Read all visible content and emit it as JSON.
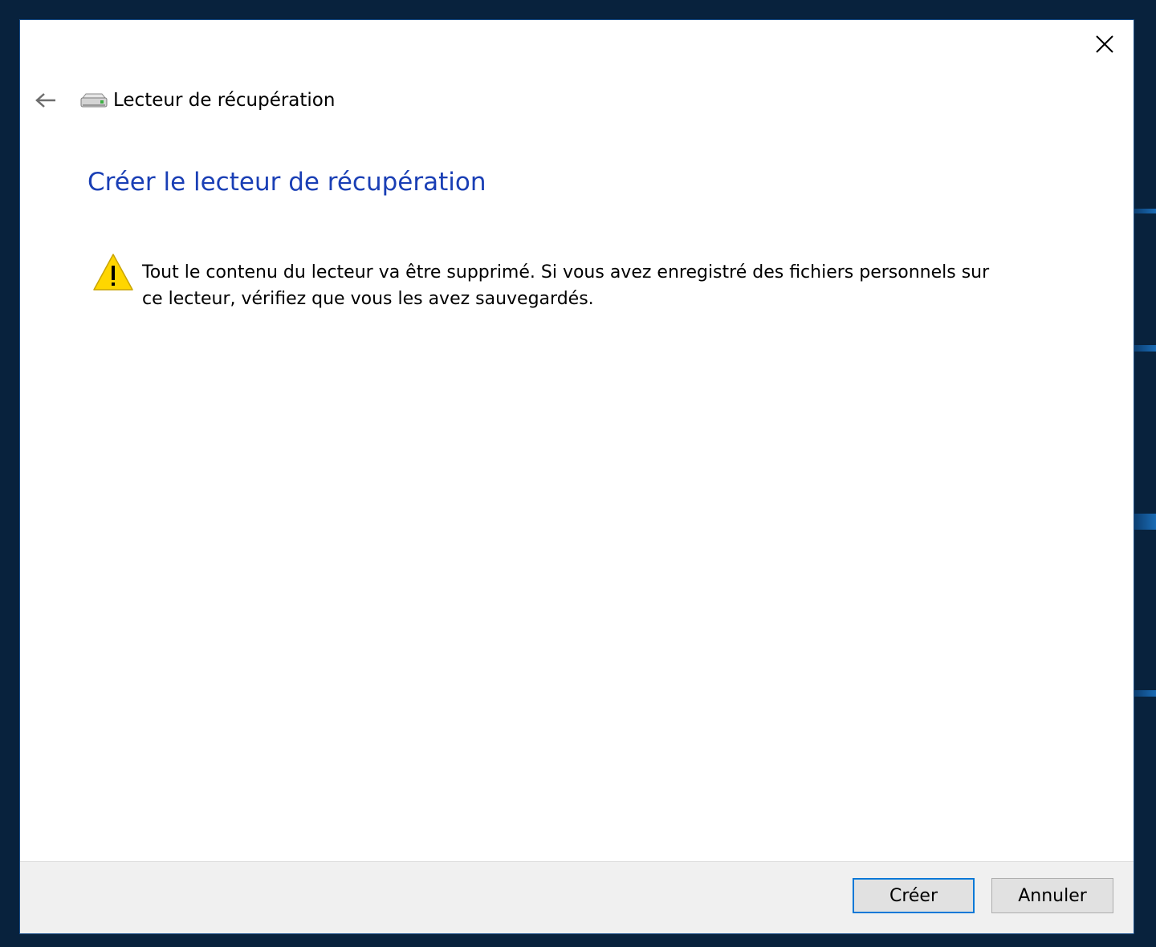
{
  "window": {
    "close_icon": "close-icon"
  },
  "nav": {
    "back_icon": "back-arrow-icon",
    "drive_icon": "drive-icon",
    "title": "Lecteur de récupération"
  },
  "page": {
    "title": "Créer le lecteur de récupération",
    "warning_icon": "warning-icon",
    "warning_text": "Tout le contenu du lecteur va être supprimé. Si vous avez enregistré des fichiers personnels sur ce lecteur, vérifiez que vous les avez sauvegardés."
  },
  "footer": {
    "create_label": "Créer",
    "cancel_label": "Annuler"
  },
  "colors": {
    "title_blue": "#1a3fb5",
    "primary_border": "#0078d7",
    "footer_bg": "#f0f0f0",
    "warning_yellow": "#ffd700"
  }
}
